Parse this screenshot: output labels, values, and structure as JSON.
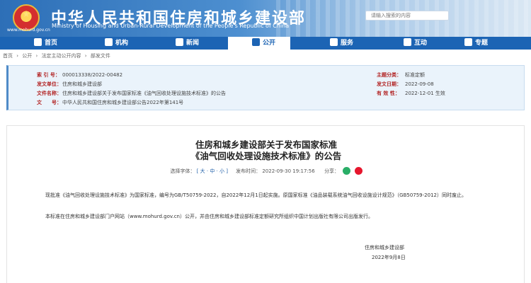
{
  "header": {
    "title_cn": "中华人民共和国住房和城乡建设部",
    "title_en": "Ministry of Housing and Urban-Rural Development of the People's Republic of China",
    "site_url": "www.mohurd.gov.cn",
    "search_placeholder": "请输入搜索的内容"
  },
  "nav": {
    "items": [
      {
        "label": "首页",
        "icon": "home-icon"
      },
      {
        "label": "机构",
        "icon": "building-icon"
      },
      {
        "label": "新闻",
        "icon": "news-icon"
      },
      {
        "label": "公开",
        "icon": "document-icon"
      },
      {
        "label": "服务",
        "icon": "service-icon"
      },
      {
        "label": "互动",
        "icon": "chat-icon"
      },
      {
        "label": "专题",
        "icon": "topic-icon"
      }
    ],
    "active_index": 3
  },
  "breadcrumb": [
    "首页",
    "›",
    "公开",
    "›",
    "法定主动公开内容",
    "›",
    "部发文件"
  ],
  "info": {
    "index_label": "索 引 号：",
    "index_value": "000013338/2022-00482",
    "issuer_label": "发文单位：",
    "issuer_value": "住房和城乡建设部",
    "name_label": "文件名称：",
    "name_value": "住房和城乡建设部关于发布国家标准《油气回收处理设施技术标准》的公告",
    "docno_label": "文　　号：",
    "docno_value": "中华人民共和国住房和城乡建设部公告2022年第141号",
    "category_label": "主题分类：",
    "category_value": "标准定额",
    "date_label": "发文日期：",
    "date_value": "2022-09-08",
    "validity_label": "有 效 性：",
    "validity_value": "2022-12-01 生效"
  },
  "article": {
    "title_line1": "住房和城乡建设部关于发布国家标准",
    "title_line2": "《油气回收处理设施技术标准》的公告",
    "font_label": "选择字体：",
    "font_options": "[ 大 · 中 · 小 ]",
    "pub_label": "发布时间：",
    "pub_value": "2022-09-30 19:17:56",
    "share_label": "分享：",
    "para1": "现批准《油气回收处理设施技术标准》为国家标准，编号为GB/T50759-2022，自2022年12月1日起实施。原国家标准《油品装载系统油气回收设施设计规范》（GB50759-2012）同时废止。",
    "para2": "本标准在住房和城乡建设部门户网站（www.mohurd.gov.cn）公开，并由住房和城乡建设部标准定额研究所组织中国计划出版社有限公司出版发行。",
    "sign_org": "住房和城乡建设部",
    "sign_date": "2022年9月8日"
  },
  "colors": {
    "nav_bg": "#1c64b4",
    "label_red": "#b22222",
    "wechat": "#2aae67",
    "weibo": "#e6162d"
  }
}
